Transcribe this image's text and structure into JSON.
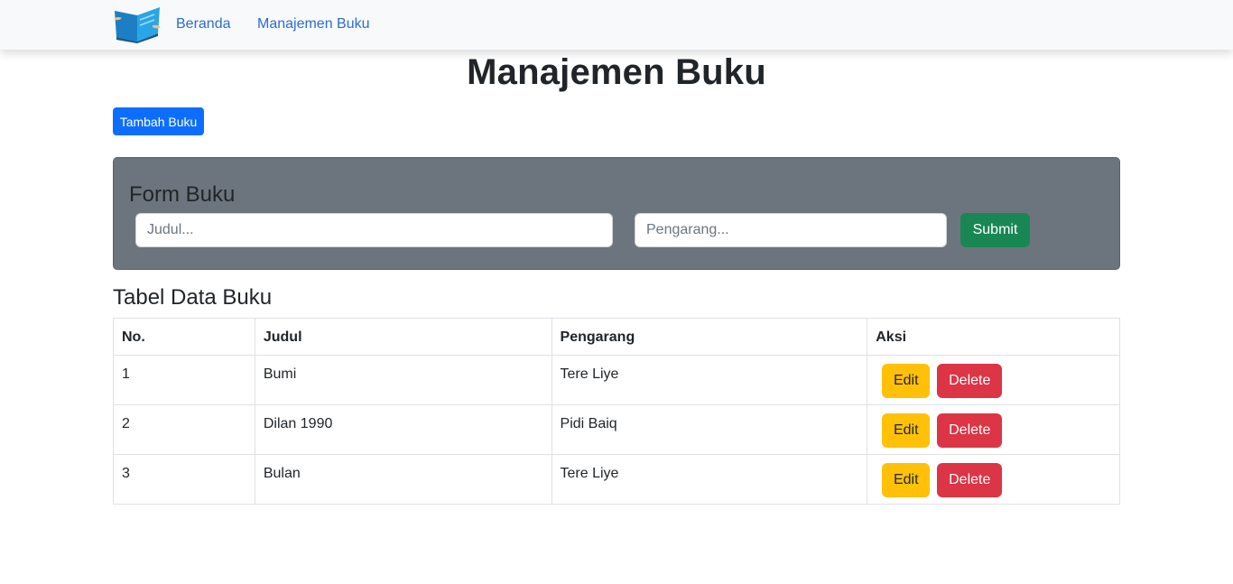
{
  "nav": {
    "logo": "book-logo",
    "links": [
      "Beranda",
      "Manajemen Buku"
    ]
  },
  "page_title": "Manajemen Buku",
  "add_button": "Tambah Buku",
  "form": {
    "title": "Form Buku",
    "judul_placeholder": "Judul...",
    "pengarang_placeholder": "Pengarang...",
    "submit_label": "Submit"
  },
  "table": {
    "title": "Tabel Data Buku",
    "headers": [
      "No.",
      "Judul",
      "Pengarang",
      "Aksi"
    ],
    "rows": [
      {
        "no": "1",
        "judul": "Bumi",
        "pengarang": "Tere Liye"
      },
      {
        "no": "2",
        "judul": "Dilan 1990",
        "pengarang": "Pidi Baiq"
      },
      {
        "no": "3",
        "judul": "Bulan",
        "pengarang": "Tere Liye"
      }
    ],
    "edit_label": "Edit",
    "delete_label": "Delete"
  },
  "colors": {
    "primary": "#0d6efd",
    "success": "#198754",
    "warning": "#ffc107",
    "danger": "#dc3545",
    "card": "#6c757d"
  }
}
